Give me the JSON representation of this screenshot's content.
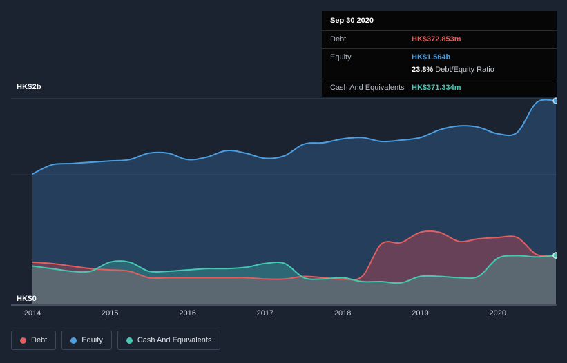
{
  "colors": {
    "background": "#1b2330",
    "debt": "#e15f5f",
    "equity": "#4b9fe1",
    "cash": "#46c8b2",
    "grid": "#3a4452",
    "axis": "#525d6c",
    "tooltip_bg": "#060606"
  },
  "tooltip": {
    "date": "Sep 30 2020",
    "rows": [
      {
        "label": "Debt",
        "value": "HK$372.853m"
      },
      {
        "label": "Equity",
        "value": "HK$1.564b",
        "ratio_bold": "23.8%",
        "ratio_text": "Debt/Equity Ratio"
      },
      {
        "label": "Cash And Equivalents",
        "value": "HK$371.334m"
      }
    ]
  },
  "legend": {
    "items": [
      {
        "label": "Debt",
        "color": "#e15f5f"
      },
      {
        "label": "Equity",
        "color": "#4b9fe1"
      },
      {
        "label": "Cash And Equivalents",
        "color": "#46c8b2"
      }
    ]
  },
  "chart_data": {
    "type": "area",
    "unit": "HK$ billions",
    "y_ticks": [
      "HK$2b",
      "HK$0"
    ],
    "ylim": [
      0,
      2
    ],
    "x_ticks": [
      2014,
      2015,
      2016,
      2017,
      2018,
      2019,
      2020
    ],
    "x": [
      2014,
      2014.25,
      2014.5,
      2014.75,
      2015,
      2015.25,
      2015.5,
      2015.75,
      2016,
      2016.25,
      2016.5,
      2016.75,
      2017,
      2017.25,
      2017.5,
      2017.75,
      2018,
      2018.25,
      2018.5,
      2018.75,
      2019,
      2019.25,
      2019.5,
      2019.75,
      2020,
      2020.25,
      2020.5,
      2020.75
    ],
    "series": [
      {
        "name": "Equity",
        "color": "#4b9fe1",
        "fill": "rgba(59,127,195,0.30)",
        "values": [
          1.0,
          1.07,
          1.08,
          1.09,
          1.1,
          1.11,
          1.16,
          1.16,
          1.11,
          1.13,
          1.18,
          1.16,
          1.12,
          1.14,
          1.23,
          1.24,
          1.27,
          1.28,
          1.25,
          1.26,
          1.28,
          1.34,
          1.37,
          1.36,
          1.31,
          1.32,
          1.55,
          1.564
        ]
      },
      {
        "name": "Debt",
        "color": "#e15f5f",
        "fill": "rgba(213,72,82,0.38)",
        "values": [
          0.32,
          0.31,
          0.29,
          0.27,
          0.26,
          0.25,
          0.2,
          0.2,
          0.2,
          0.2,
          0.2,
          0.2,
          0.19,
          0.19,
          0.21,
          0.2,
          0.19,
          0.21,
          0.46,
          0.47,
          0.55,
          0.55,
          0.48,
          0.5,
          0.51,
          0.51,
          0.38,
          0.373
        ]
      },
      {
        "name": "Cash And Equivalents",
        "color": "#46c8b2",
        "fill": "rgba(66,196,173,0.30)",
        "values": [
          0.29,
          0.27,
          0.25,
          0.25,
          0.32,
          0.32,
          0.25,
          0.25,
          0.26,
          0.27,
          0.27,
          0.28,
          0.31,
          0.31,
          0.2,
          0.19,
          0.2,
          0.17,
          0.17,
          0.16,
          0.21,
          0.21,
          0.2,
          0.21,
          0.35,
          0.37,
          0.36,
          0.371
        ]
      }
    ]
  }
}
